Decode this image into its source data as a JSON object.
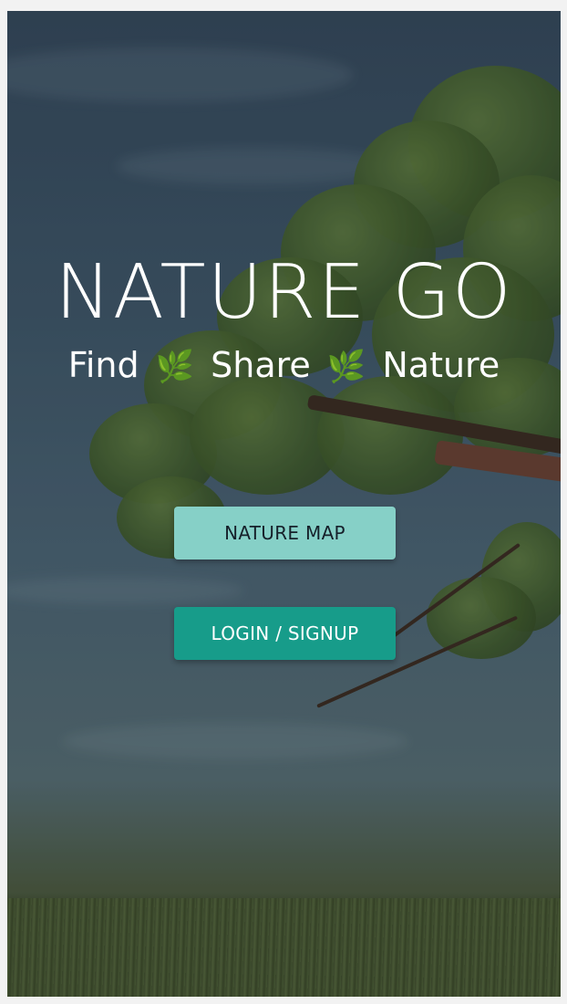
{
  "app": {
    "title": "NATURE GO",
    "tagline_parts": [
      "Find",
      "Share",
      "Nature"
    ],
    "tagline_icon": "herb-icon"
  },
  "buttons": {
    "nature_map": "NATURE MAP",
    "login_signup": "LOGIN / SIGNUP"
  },
  "colors": {
    "nature_map_button": "#86d0c7",
    "login_button": "#179c8a",
    "title_text": "#ffffff"
  },
  "background": {
    "icon": "tree-landscape-photo"
  }
}
